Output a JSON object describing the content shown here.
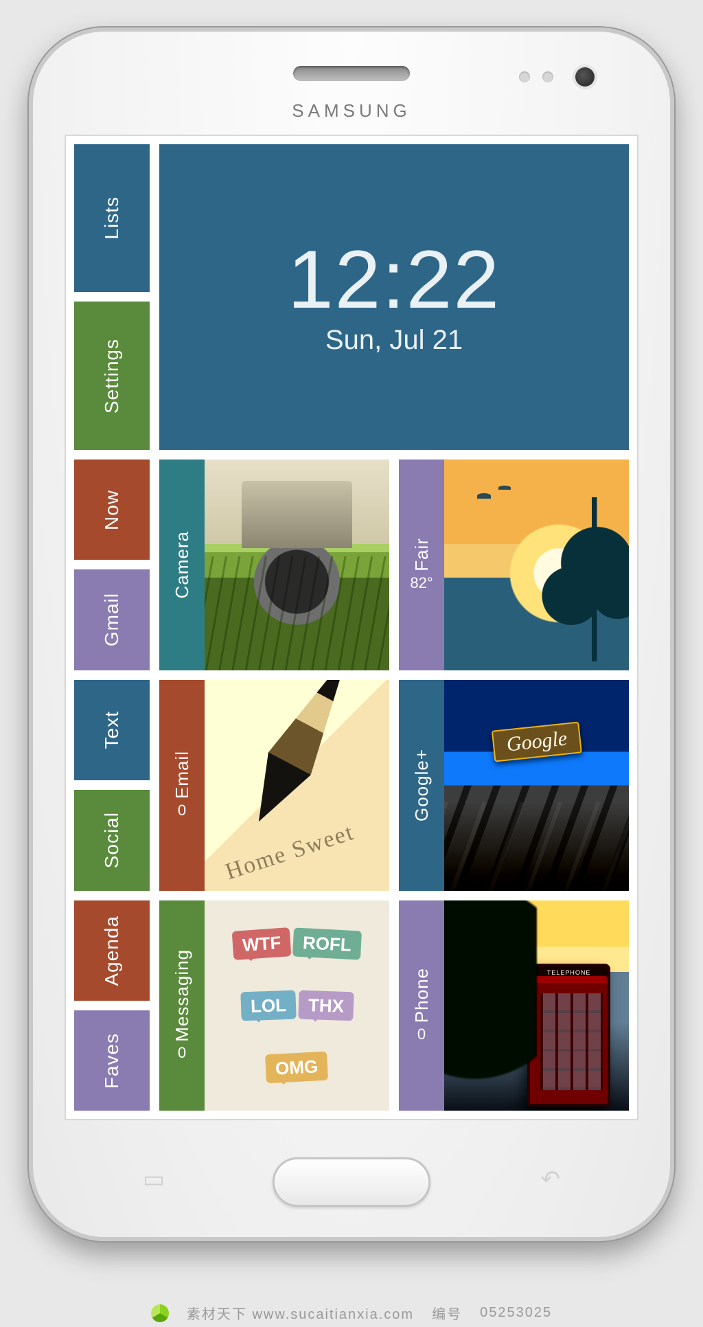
{
  "device": {
    "brand": "SAMSUNG"
  },
  "clock": {
    "time": "12:22",
    "date": "Sun, Jul 21"
  },
  "sidebar": {
    "row1": [
      "Lists",
      "Settings"
    ],
    "row2": [
      "Now",
      "Gmail"
    ],
    "row3": [
      "Text",
      "Social"
    ],
    "row4": [
      "Agenda",
      "Faves"
    ]
  },
  "cards": {
    "camera": {
      "label": "Camera"
    },
    "weather": {
      "label": "Fair",
      "temp": "82°"
    },
    "email": {
      "label": "Email",
      "count": "0"
    },
    "googleplus": {
      "label": "Google+"
    },
    "messaging": {
      "label": "Messaging",
      "count": "0",
      "bubbles": [
        "WTF",
        "ROFL",
        "LOL",
        "THX",
        "OMG"
      ]
    },
    "phone": {
      "label": "Phone",
      "count": "0",
      "booth_sign": "TELEPHONE"
    }
  },
  "watermark": {
    "site": "素材天下 www.sucaitianxia.com",
    "code_label": "编号",
    "code": "05253025"
  }
}
